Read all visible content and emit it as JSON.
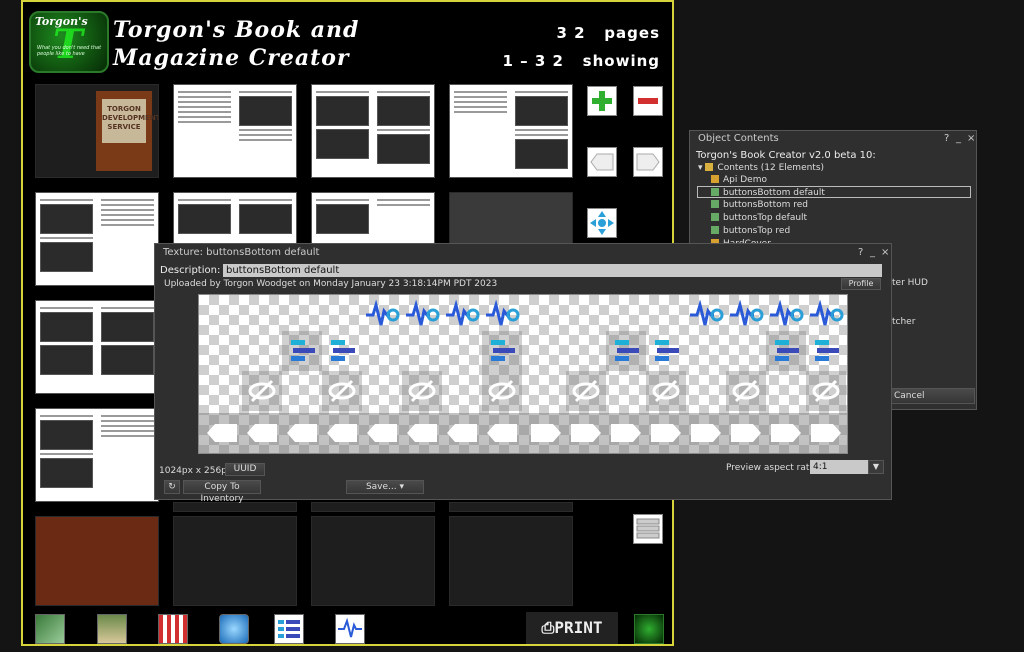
{
  "book": {
    "title_line1": "Torgon's Book and",
    "title_line2": "Magazine Creator",
    "page_count": "3 2",
    "pages_label": "pages",
    "showing_range": "1 – 3 2",
    "showing_label": "showing",
    "logo_text": "Torgon's",
    "logo_tagline": "What you don't need that people like to have",
    "cover_text": "TORGON DEVELOPMENT SERVICE",
    "print_label": "PRINT",
    "icons": [
      "plus-icon",
      "minus-icon",
      "left-arrow-icon",
      "right-arrow-icon",
      "move-arrows-icon",
      "list-icon"
    ],
    "bottom_icons": [
      "landscape-icon",
      "book-icon",
      "store-icon",
      "globe-icon",
      "buttons-list-icon",
      "api-icon"
    ],
    "colors": {
      "frame": "#d6d43a",
      "accent_green": "#2fae2f",
      "accent_red": "#d23030",
      "accent_blue": "#2a9fd8"
    }
  },
  "object_contents": {
    "title": "Object Contents",
    "object_name": "Torgon's Book Creator v2.0 beta 10:",
    "folder": "Contents (12 Elements)",
    "items": [
      {
        "label": "Api Demo"
      },
      {
        "label": "buttonsBottom default",
        "selected": true
      },
      {
        "label": "buttonsBottom red"
      },
      {
        "label": "buttonsTop default"
      },
      {
        "label": "buttonsTop red"
      },
      {
        "label": "HardCover"
      }
    ],
    "partial_text_1": "ter HUD",
    "partial_text_2": "tcher",
    "cancel_label": "Cancel"
  },
  "texture": {
    "window_title": "Texture: buttonsBottom default",
    "description_label": "Description:",
    "description_value": "buttonsBottom default",
    "uploaded_text": "Uploaded by Torgon Woodget on Monday January 23 3:18:14PM PDT 2023",
    "profile_label": "Profile",
    "dimensions": "1024px x 256px",
    "uuid_label": "UUID",
    "copy_label": "Copy To Inventory",
    "save_label": "Save...",
    "aspect_label": "Preview aspect ratio",
    "aspect_value": "4:1"
  }
}
